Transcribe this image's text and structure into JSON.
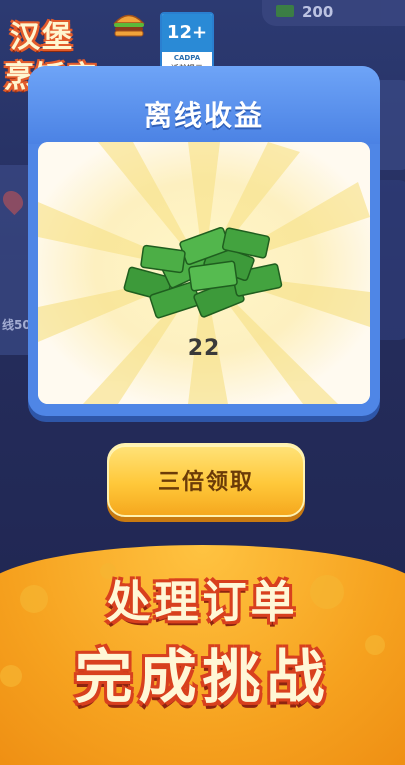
{
  "logo": {
    "line1": "汉堡",
    "line2": "烹饪店"
  },
  "age_rating": {
    "rating": "12+",
    "org": "CADPA",
    "note": "适龄提示"
  },
  "hud": {
    "cash": "200"
  },
  "background": {
    "left_label": "线50"
  },
  "popup": {
    "title": "离线收益",
    "reward_amount": "22"
  },
  "claim_button": {
    "label": "三倍领取"
  },
  "promo_banner": {
    "line1": "处理订单",
    "line2": "完成挑战"
  },
  "colors": {
    "popup_blue": "#4f86e6",
    "button_yellow": "#ffc83a",
    "banner_orange": "#f6a21f",
    "cash_green": "#3d9a3a"
  }
}
